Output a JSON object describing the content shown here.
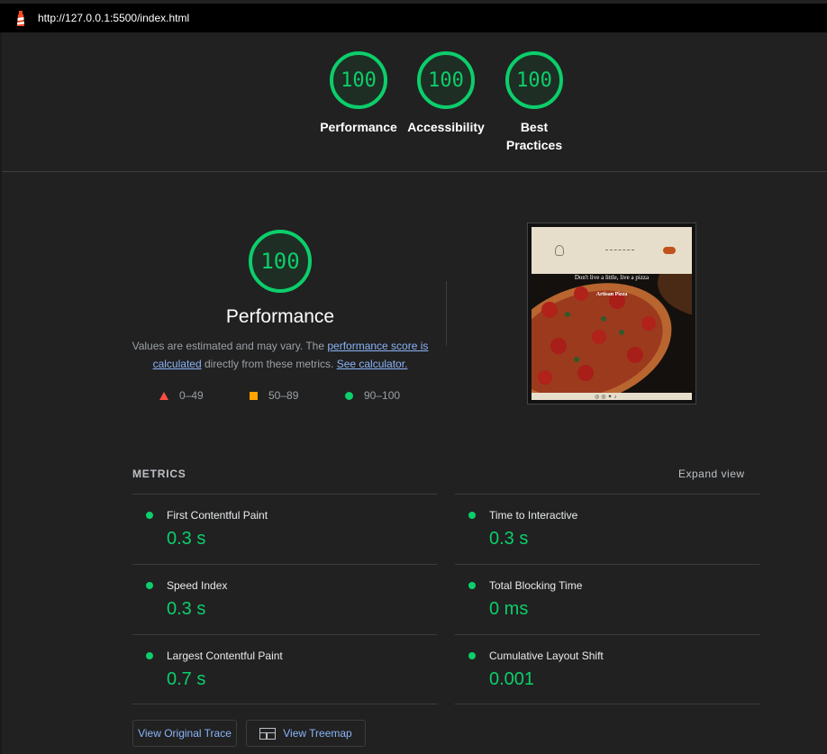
{
  "browser": {
    "url": "http://127.0.0.1:5500/index.html"
  },
  "top_scores": [
    {
      "label": "Performance",
      "score": "100"
    },
    {
      "label": "Accessibility",
      "score": "100"
    },
    {
      "label": "Best Practices",
      "score": "100"
    }
  ],
  "performance": {
    "score": "100",
    "title": "Performance",
    "desc_prefix": "Values are estimated and may vary. The ",
    "desc_link1": "performance score is calculated",
    "desc_middle": " directly from these metrics. ",
    "desc_link2": "See calculator."
  },
  "legend": [
    {
      "range": "0–49",
      "color": "#ff4e42"
    },
    {
      "range": "50–89",
      "color": "#ffa400"
    },
    {
      "range": "90–100",
      "color": "#0cce6b"
    }
  ],
  "screenshot": {
    "hero_line1": "Don't live a little, live a pizza",
    "hero_line2": "Artisan Pizza"
  },
  "metrics": {
    "heading": "METRICS",
    "expand_label": "Expand view",
    "items": [
      {
        "label": "First Contentful Paint",
        "value": "0.3 s"
      },
      {
        "label": "Time to Interactive",
        "value": "0.3 s"
      },
      {
        "label": "Speed Index",
        "value": "0.3 s"
      },
      {
        "label": "Total Blocking Time",
        "value": "0 ms"
      },
      {
        "label": "Largest Contentful Paint",
        "value": "0.7 s"
      },
      {
        "label": "Cumulative Layout Shift",
        "value": "0.001"
      }
    ]
  },
  "buttons": {
    "original_trace": "View Original Trace",
    "treemap": "View Treemap"
  },
  "colors": {
    "pass": "#0cce6b",
    "average": "#ffa400",
    "fail": "#ff4e42",
    "link": "#8ab4f8"
  }
}
